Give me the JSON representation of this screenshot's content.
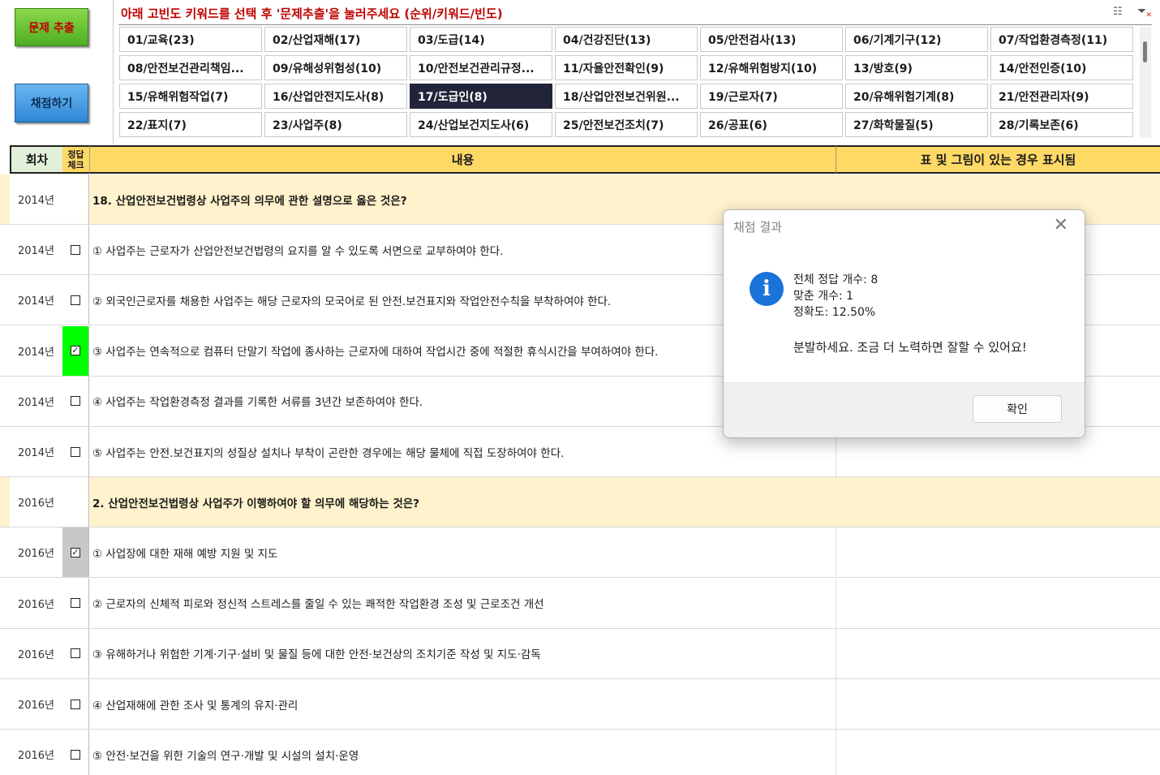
{
  "toolbar": {
    "extract_label": "문제 추출",
    "grade_label": "채점하기"
  },
  "keyword_panel": {
    "instruction": "아래 고빈도 키워드를 선택 후 '문제추출'을 눌러주세요 (순위/키워드/빈도)",
    "icons": [
      "multi-select-icon",
      "clear-filter-icon"
    ],
    "selected_index": 16,
    "keywords": [
      "01/교육(23)",
      "02/산업재해(17)",
      "03/도급(14)",
      "04/건강진단(13)",
      "05/안전검사(13)",
      "06/기계기구(12)",
      "07/작업환경측정(11)",
      "08/안전보건관리책임...",
      "09/유해성위험성(10)",
      "10/안전보건관리규정...",
      "11/자율안전확인(9)",
      "12/유해위험방지(10)",
      "13/방호(9)",
      "14/안전인증(10)",
      "15/유해위험작업(7)",
      "16/산업안전지도사(8)",
      "17/도급인(8)",
      "18/산업안전보건위원...",
      "19/근로자(7)",
      "20/유해위험기계(8)",
      "21/안전관리자(9)",
      "22/표지(7)",
      "23/사업주(8)",
      "24/산업보건지도사(6)",
      "25/안전보건조치(7)",
      "26/공표(6)",
      "27/화학물질(5)",
      "28/기록보존(6)"
    ]
  },
  "table": {
    "headers": {
      "round": "회차",
      "check_line1": "정답",
      "check_line2": "체크",
      "content": "내용",
      "note": "표 및 그림이 있는 경우 표시됨"
    },
    "rows": [
      {
        "year": "2014년",
        "type": "question",
        "checkbox": "none",
        "highlight": "none",
        "text": "18. 산업안전보건법령상 사업주의 의무에 관한 설명으로 옳은 것은?"
      },
      {
        "year": "2014년",
        "type": "option",
        "checkbox": "unchecked",
        "highlight": "none",
        "text": "① 사업주는 근로자가 산업안전보건법령의 요지를 알 수 있도록 서면으로 교부하여야 한다."
      },
      {
        "year": "2014년",
        "type": "option",
        "checkbox": "unchecked",
        "highlight": "none",
        "text": "② 외국인근로자를 채용한 사업주는 해당 근로자의 모국어로 된 안전.보건표지와 작업안전수칙을 부착하여야 한다."
      },
      {
        "year": "2014년",
        "type": "option",
        "checkbox": "checked",
        "highlight": "green",
        "text": "③ 사업주는 연속적으로 컴퓨터 단말기 작업에 종사하는 근로자에 대하여 작업시간 중에 적절한 휴식시간을 부여하여야 한다."
      },
      {
        "year": "2014년",
        "type": "option",
        "checkbox": "unchecked",
        "highlight": "none",
        "text": "④ 사업주는 작업환경측정 결과를 기록한 서류를 3년간 보존하여야 한다."
      },
      {
        "year": "2014년",
        "type": "option",
        "checkbox": "unchecked",
        "highlight": "none",
        "text": "⑤ 사업주는 안전.보건표지의 성질상 설치나 부착이 곤란한 경우에는 해당 물체에 직접 도장하여야 한다."
      },
      {
        "year": "2016년",
        "type": "question",
        "checkbox": "none",
        "highlight": "none",
        "text": "2. 산업안전보건법령상 사업주가 이행하여야 할 의무에 해당하는 것은?"
      },
      {
        "year": "2016년",
        "type": "option",
        "checkbox": "checked",
        "highlight": "gray",
        "text": "① 사업장에 대한 재해 예방 지원 및 지도"
      },
      {
        "year": "2016년",
        "type": "option",
        "checkbox": "unchecked",
        "highlight": "none",
        "text": "② 근로자의 신체적 피로와 정신적 스트레스를 줄일 수 있는 쾌적한 작업환경 조성 및 근로조건 개선"
      },
      {
        "year": "2016년",
        "type": "option",
        "checkbox": "unchecked",
        "highlight": "none",
        "text": "③ 유해하거나 위험한 기계·기구·설비 및 물질 등에 대한 안전·보건상의 조치기준 작성 및 지도·감독"
      },
      {
        "year": "2016년",
        "type": "option",
        "checkbox": "unchecked",
        "highlight": "none",
        "text": "④ 산업재해에 관한 조사 및 통계의 유지·관리"
      },
      {
        "year": "2016년",
        "type": "option",
        "checkbox": "unchecked",
        "highlight": "none",
        "text": "⑤ 안전·보건을 위한 기술의 연구·개발 및 시설의 설치·운영"
      }
    ]
  },
  "dialog": {
    "title": "채점 결과",
    "close_icon": "close-icon",
    "info_icon": "info-icon",
    "line_total": "전체 정답 개수: 8",
    "line_correct": "맞춘 개수: 1",
    "line_accuracy": "정확도: 12.50%",
    "message": "분발하세요. 조금 더 노력하면 잘할 수 있어요!",
    "ok_label": "확인"
  },
  "colors": {
    "header_fill": "#ffd966",
    "question_fill": "#fff2cc",
    "correct_highlight": "#00ff00",
    "selected_keyword": "#22243a",
    "instruction_text": "#c00000"
  }
}
